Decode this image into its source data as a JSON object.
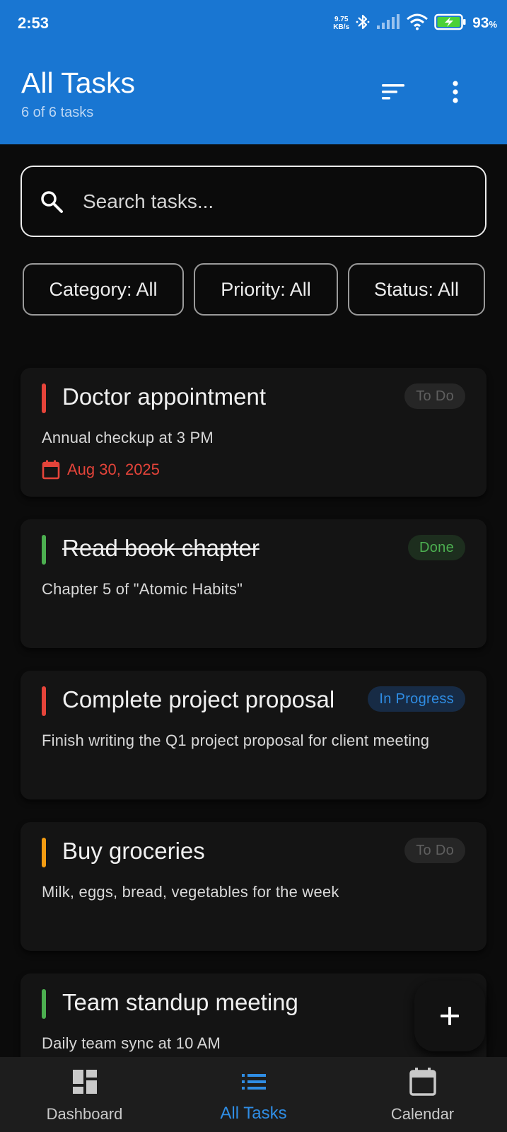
{
  "status_bar": {
    "time": "2:53",
    "net_speed_value": "9.75",
    "net_speed_unit": "KB/s",
    "battery_percent": "93",
    "battery_unit": "%",
    "icons": [
      "bluetooth-icon",
      "signal-icon",
      "wifi-icon",
      "battery-charging-icon"
    ]
  },
  "header": {
    "title": "All Tasks",
    "subtitle": "6 of 6 tasks",
    "actions": [
      "sort-icon",
      "more-vert-icon"
    ]
  },
  "search": {
    "placeholder": "Search tasks...",
    "value": ""
  },
  "filters": {
    "category": "Category: All",
    "priority": "Priority: All",
    "status": "Status: All"
  },
  "tasks": [
    {
      "title": "Doctor appointment",
      "description": "Annual checkup at 3 PM",
      "status": "To Do",
      "priority_color": "#e5443a",
      "due": "Aug 30, 2025",
      "done": false
    },
    {
      "title": "Read book chapter",
      "description": "Chapter 5 of \"Atomic Habits\"",
      "status": "Done",
      "priority_color": "#4caf50",
      "done": true
    },
    {
      "title": "Complete project proposal",
      "description": "Finish writing the Q1 project proposal for client meeting",
      "status": "In Progress",
      "priority_color": "#e5443a",
      "done": false
    },
    {
      "title": "Buy groceries",
      "description": "Milk, eggs, bread, vegetables for the week",
      "status": "To Do",
      "priority_color": "#f39c12",
      "done": false
    },
    {
      "title": "Team standup meeting",
      "description": "Daily team sync at 10 AM",
      "priority_color": "#4caf50",
      "done": false
    }
  ],
  "fab": {
    "icon": "add-icon"
  },
  "bottom_nav": {
    "items": [
      {
        "label": "Dashboard",
        "icon": "dashboard-icon",
        "active": false
      },
      {
        "label": "All Tasks",
        "icon": "list-icon",
        "active": true
      },
      {
        "label": "Calendar",
        "icon": "calendar-icon",
        "active": false
      }
    ]
  },
  "colors": {
    "primary": "#1976d2",
    "accent_blue": "#2f8de4",
    "background": "#0b0b0b",
    "card": "#141414",
    "priority_high": "#e5443a",
    "priority_medium": "#f39c12",
    "priority_low": "#4caf50"
  }
}
